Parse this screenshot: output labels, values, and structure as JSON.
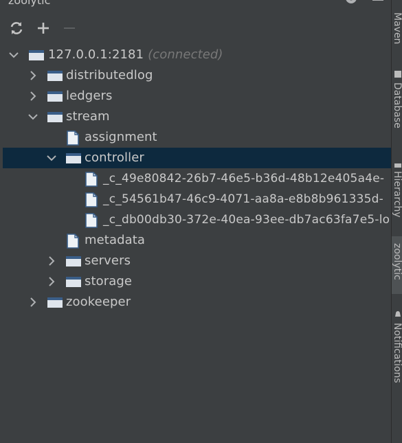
{
  "panel": {
    "title": "zoolytic"
  },
  "toolbar": {
    "refresh": "refresh-icon",
    "add": "add-icon",
    "remove": "remove-icon"
  },
  "tree": {
    "root": {
      "label": "127.0.0.1:2181",
      "status": "(connected)",
      "expanded": true
    },
    "nodes": [
      {
        "label": "distributedlog",
        "type": "folder",
        "expanded": false
      },
      {
        "label": "ledgers",
        "type": "folder",
        "expanded": false
      },
      {
        "label": "stream",
        "type": "folder",
        "expanded": true
      },
      {
        "label": "assignment",
        "type": "file"
      },
      {
        "label": "controller",
        "type": "folder",
        "expanded": true,
        "selected": true
      },
      {
        "label": "_c_49e80842-26b7-46e5-b36d-48b12e405a4e-",
        "type": "file"
      },
      {
        "label": "_c_54561b47-46c9-4071-aa8a-e8b8b961335d-",
        "type": "file"
      },
      {
        "label": "_c_db00db30-372e-40ea-93ee-db7ac63fa7e5-lo",
        "type": "file"
      },
      {
        "label": "metadata",
        "type": "file"
      },
      {
        "label": "servers",
        "type": "folder",
        "expanded": false
      },
      {
        "label": "storage",
        "type": "folder",
        "expanded": false
      },
      {
        "label": "zookeeper",
        "type": "folder",
        "expanded": false
      }
    ]
  },
  "side_tabs": [
    {
      "label": "Maven",
      "active": false
    },
    {
      "label": "Database",
      "active": false
    },
    {
      "label": "Hierarchy",
      "active": false
    },
    {
      "label": "zoolytic",
      "active": true
    },
    {
      "label": "Notifications",
      "active": false
    }
  ],
  "colors": {
    "background": "#3c3f41",
    "selection": "#0d293e",
    "text": "#c9c9c9",
    "muted": "#787878"
  }
}
